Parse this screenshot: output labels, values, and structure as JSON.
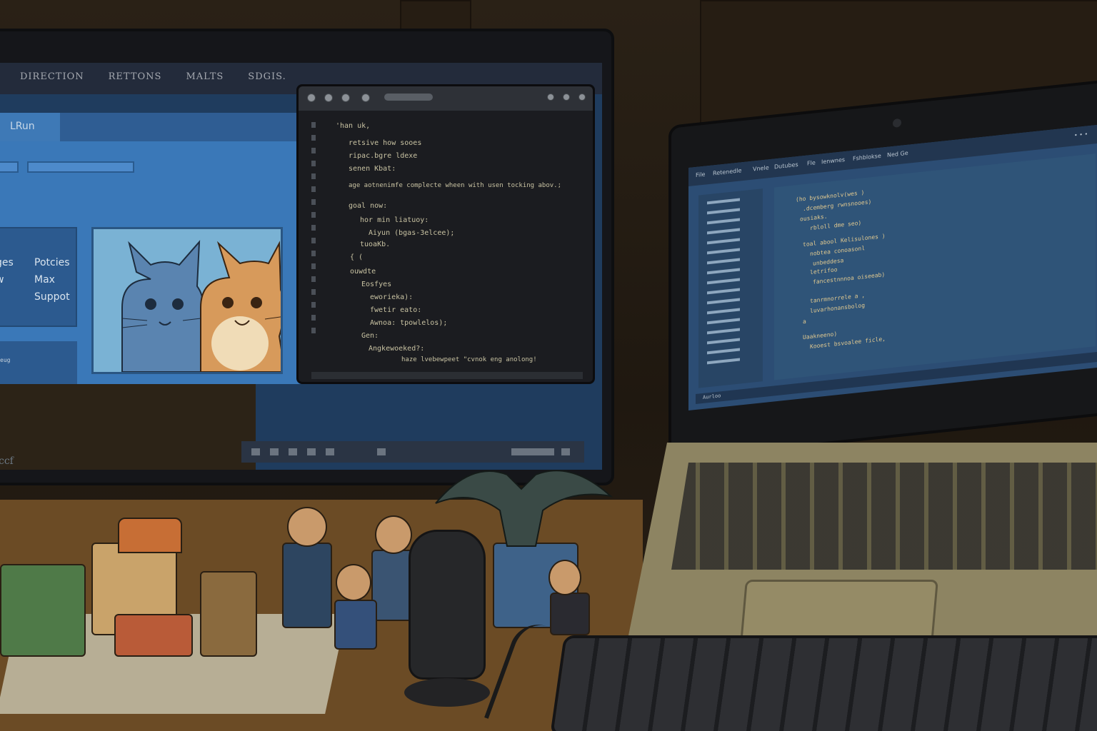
{
  "scene": "desk with monitor, code window, laptop and toys",
  "monitor": {
    "menu": [
      "DIRECTION",
      "RETTONS",
      "MALTS",
      "SDGIS."
    ],
    "tab": "LRun",
    "nav": [
      "Potcies",
      "Max",
      "Suppot"
    ],
    "nav_left_partial": [
      "ges",
      "w"
    ],
    "lower_text": "eug",
    "dark_panel_text": "ccf"
  },
  "code_window": {
    "lines": [
      "'han uk,",
      "retsive how sooes",
      "ripac.bgre ldexe",
      "senen Kbat:",
      "age aotnenimfe complecte wheen with usen tocking abov.;",
      "goal now:",
      "hor min liatuoy:",
      "Aiyun (bgas-3elcee);",
      "tuoaKb.",
      "{ (",
      "ouwdte",
      "Eosfyes",
      "eworieka):",
      "fwetir eato:",
      "Awnoa: tpowlelos);",
      "Gen:",
      "Angkewoeked?:",
      "haze lvebewpeet \"cvnok eng anolong!"
    ]
  },
  "laptop": {
    "menu": [
      "File",
      "Retenedle",
      "Vnele",
      "Dutubes",
      "Fle",
      "Ienwnes",
      "Fshblokse",
      "Ned Ge"
    ],
    "code_lines": [
      "(ho bysowknolv(wes )",
      ".dcemberg rwnsnooes)",
      "ousiaks.",
      "rbloll dme seo)",
      "toal abool Kelisulones )",
      "nobtea conoasonl",
      "unbeddesa",
      "letrifoo",
      "fancestnnnoa oiseeab)",
      "tanrmnorrele a ,",
      "luvarhonansbolog",
      "a",
      "Uaakneeno)",
      "Kooest bsvoalee ficle,"
    ],
    "status": "Aurloo"
  }
}
